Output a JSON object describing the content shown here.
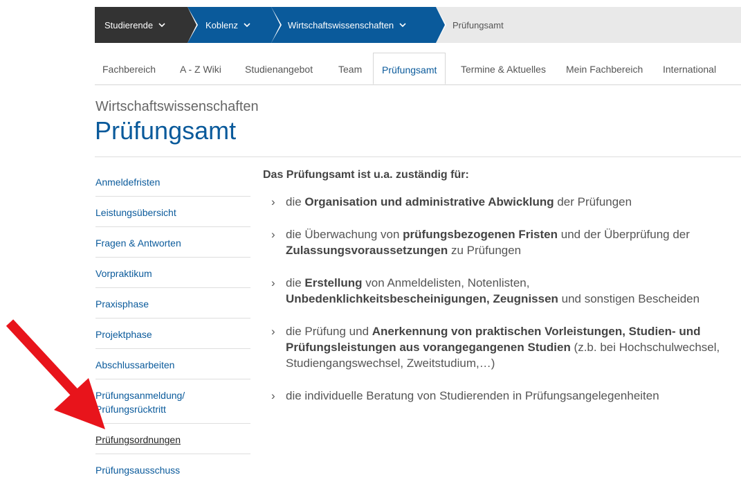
{
  "breadcrumb": {
    "items": [
      {
        "label": "Studierende"
      },
      {
        "label": "Koblenz"
      },
      {
        "label": "Wirtschaftswissenschaften"
      },
      {
        "label": "Prüfungsamt"
      }
    ]
  },
  "nav": {
    "tabs": [
      {
        "label": "Fachbereich"
      },
      {
        "label": "A - Z Wiki"
      },
      {
        "label": "Studienangebot"
      },
      {
        "label": "Team"
      },
      {
        "label": "Prüfungsamt"
      },
      {
        "label": "Termine & Aktuelles"
      },
      {
        "label": "Mein Fachbereich"
      },
      {
        "label": "International"
      }
    ],
    "active_tab": "Prüfungsamt"
  },
  "page": {
    "subtitle": "Wirtschaftswissenschaften",
    "title": "Prüfungsamt"
  },
  "sidebar": {
    "items": [
      {
        "label": "Anmeldefristen"
      },
      {
        "label": "Leistungsübersicht"
      },
      {
        "label": "Fragen & Antworten"
      },
      {
        "label": "Vorpraktikum"
      },
      {
        "label": "Praxisphase"
      },
      {
        "label": "Projektphase"
      },
      {
        "label": "Abschlussarbeiten"
      },
      {
        "label": "Prüfungsanmeldung/ Prüfungsrücktritt",
        "line1": "Prüfungsanmeldung/",
        "line2": "Prüfungsrücktritt"
      },
      {
        "label": "Prüfungsordnungen"
      },
      {
        "label": "Prüfungsausschuss"
      }
    ],
    "highlighted_item": "Prüfungsordnungen"
  },
  "main": {
    "intro": "Das Prüfungsamt ist u.a. zuständig für:",
    "bullets": [
      {
        "parts": [
          {
            "t": "die "
          },
          {
            "t": "Organisation und administrative Abwicklung",
            "b": true
          },
          {
            "t": " der Prüfungen"
          }
        ]
      },
      {
        "parts": [
          {
            "t": "die Überwachung von "
          },
          {
            "t": "prüfungsbezogenen Fristen",
            "b": true
          },
          {
            "t": " und der Überprüfung der "
          },
          {
            "t": "Zulassungsvoraussetzungen",
            "b": true
          },
          {
            "t": " zu Prüfungen"
          }
        ]
      },
      {
        "parts": [
          {
            "t": "die "
          },
          {
            "t": "Erstellung",
            "b": true
          },
          {
            "t": " von Anmeldelisten, Notenlisten, "
          },
          {
            "t": "Unbedenklichkeitsbescheinigungen, Zeugnissen",
            "b": true
          },
          {
            "t": " und sonstigen Bescheiden"
          }
        ]
      },
      {
        "parts": [
          {
            "t": "die Prüfung und "
          },
          {
            "t": "Anerkennung von praktischen Vorleistungen, Studien- und Prüfungsleistungen aus vorangegangenen Studien",
            "b": true
          },
          {
            "t": " (z.b. bei Hochschulwechsel, Studiengangswechsel, Zweitstudium,…)"
          }
        ]
      },
      {
        "parts": [
          {
            "t": "die individuelle Beratung von Studierenden in Prüfungsangelegenheiten"
          }
        ]
      }
    ]
  },
  "icons": {
    "breadcrumb_dropdown": "chevron-down-icon",
    "bullet_marker": "chevron-right-icon",
    "annotation": "red-arrow-icon"
  },
  "colors": {
    "brand_blue": "#0a5a9b",
    "dark": "#333333",
    "annotation_red": "#e8141b"
  }
}
